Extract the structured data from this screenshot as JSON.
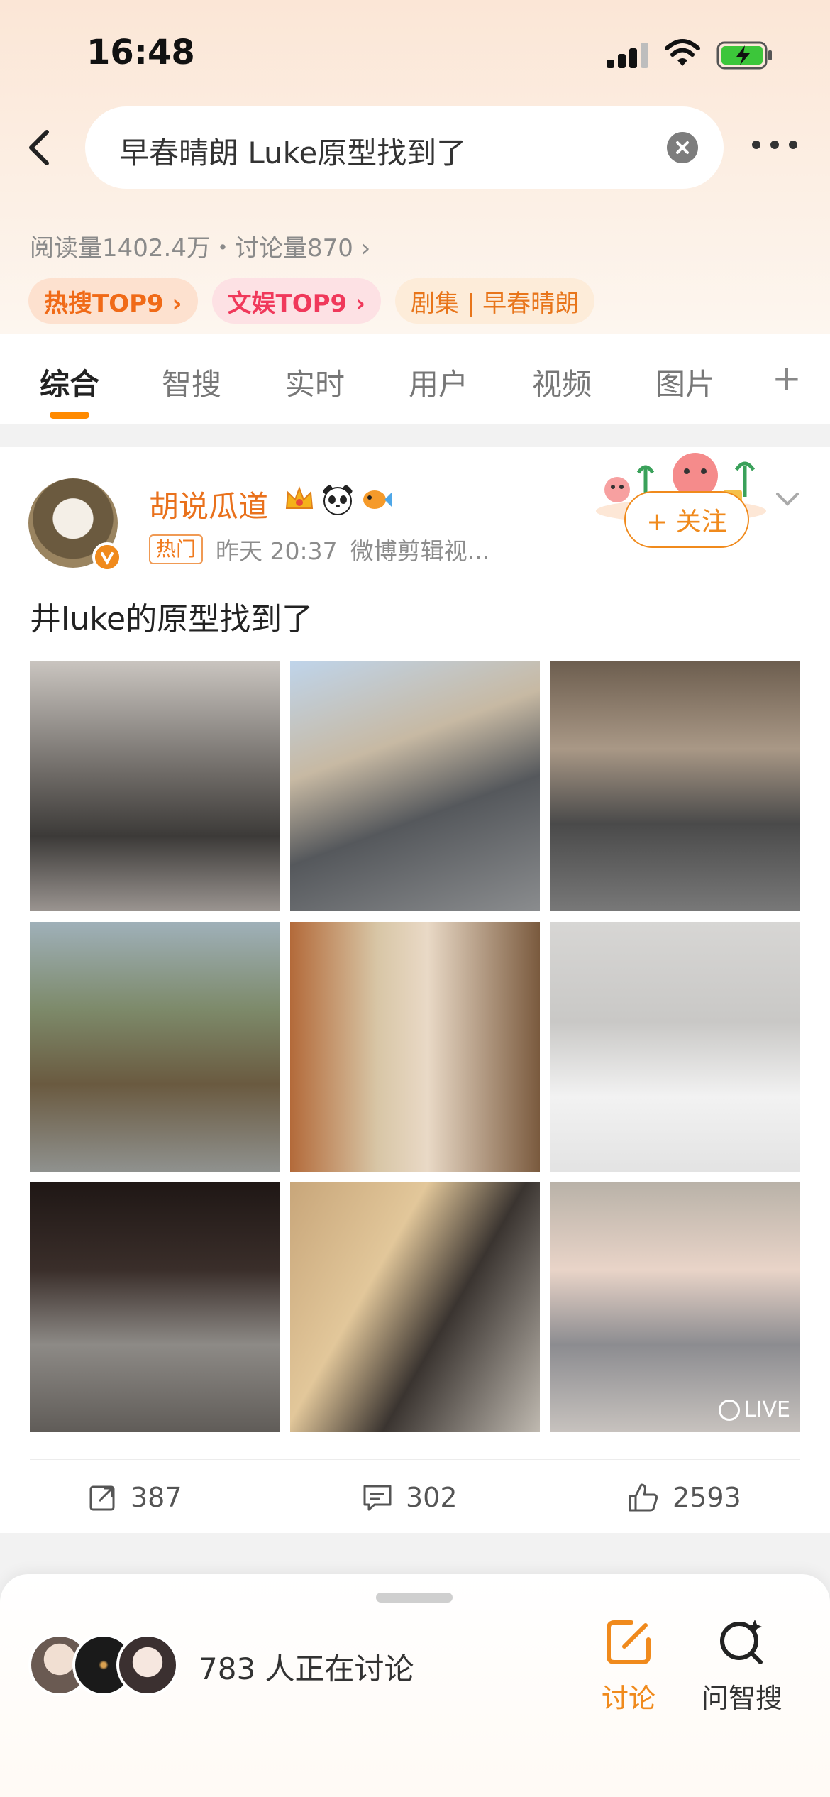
{
  "status_bar": {
    "time": "16:48"
  },
  "search": {
    "query": "早春晴朗 Luke原型找到了"
  },
  "topic_stats": "阅读量1402.4万・讨论量870 ›",
  "pills": [
    {
      "label": "热搜TOP9 ›"
    },
    {
      "label": "文娱TOP9 ›"
    },
    {
      "label": "剧集 | 早春晴朗"
    }
  ],
  "tabs": [
    {
      "label": "综合",
      "active": true
    },
    {
      "label": "智搜"
    },
    {
      "label": "实时"
    },
    {
      "label": "用户"
    },
    {
      "label": "视频"
    },
    {
      "label": "图片"
    }
  ],
  "tab_plus": "+",
  "post": {
    "username": "胡说瓜道",
    "hot_tag": "热门",
    "time": "昨天 20:37",
    "source": "微博剪辑视...",
    "follow_label": "+ 关注",
    "text": "井luke的原型找到了",
    "live_label": "LIVE",
    "repost_count": "387",
    "comment_count": "302",
    "like_count": "2593"
  },
  "bottom_bar": {
    "discuss_text": "783 人正在讨论",
    "discuss_label": "讨论",
    "ask_label": "问智搜"
  },
  "colors": {
    "accent_orange": "#f08a1c",
    "hot_pill_text": "#f06a17",
    "ent_pill_text": "#f0395b",
    "username": "#e9711c"
  }
}
